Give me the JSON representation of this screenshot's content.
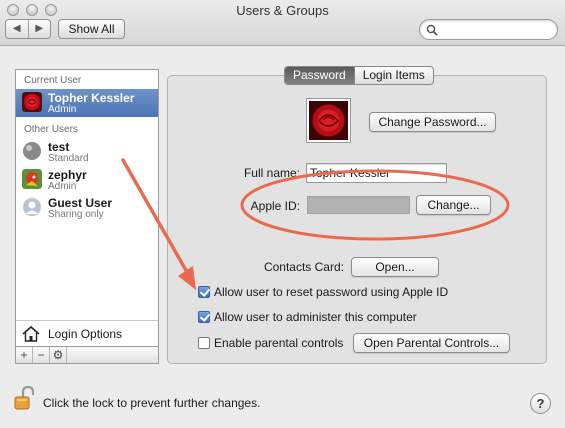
{
  "window": {
    "title": "Users & Groups"
  },
  "toolbar": {
    "back_label": "◀",
    "forward_label": "▶",
    "show_all_label": "Show All",
    "search_placeholder": ""
  },
  "sidebar": {
    "current_user_header": "Current User",
    "other_users_header": "Other Users",
    "users": [
      {
        "name": "Topher Kessler",
        "role": "Admin",
        "selected": true,
        "avatar": "red-rose-avatar"
      },
      {
        "name": "test",
        "role": "Standard",
        "avatar": "gray-ball-avatar"
      },
      {
        "name": "zephyr",
        "role": "Admin",
        "avatar": "parrot-avatar"
      },
      {
        "name": "Guest User",
        "role": "Sharing only",
        "avatar": "generic-person-avatar"
      }
    ],
    "login_options_label": "Login Options",
    "add_label": "+",
    "remove_label": "−",
    "action_label": "⚙"
  },
  "tabs": [
    {
      "label": "Password",
      "active": true
    },
    {
      "label": "Login Items",
      "active": false
    }
  ],
  "account": {
    "change_password_label": "Change Password...",
    "full_name_label": "Full name:",
    "full_name_value": "Topher Kessler",
    "apple_id_label": "Apple ID:",
    "apple_id_value": "",
    "change_apple_id_label": "Change...",
    "contacts_card_label": "Contacts Card:",
    "open_label": "Open...",
    "checkboxes": [
      {
        "label": "Allow user to reset password using Apple ID",
        "checked": true
      },
      {
        "label": "Allow user to administer this computer",
        "checked": true
      },
      {
        "label": "Enable parental controls",
        "checked": false
      }
    ],
    "open_parental_controls_label": "Open Parental Controls..."
  },
  "footer": {
    "lock_text": "Click the lock to prevent further changes.",
    "help_label": "?"
  },
  "colors": {
    "annotation_red": "#ea6a4f",
    "selection_blue": "#5a80bd"
  }
}
